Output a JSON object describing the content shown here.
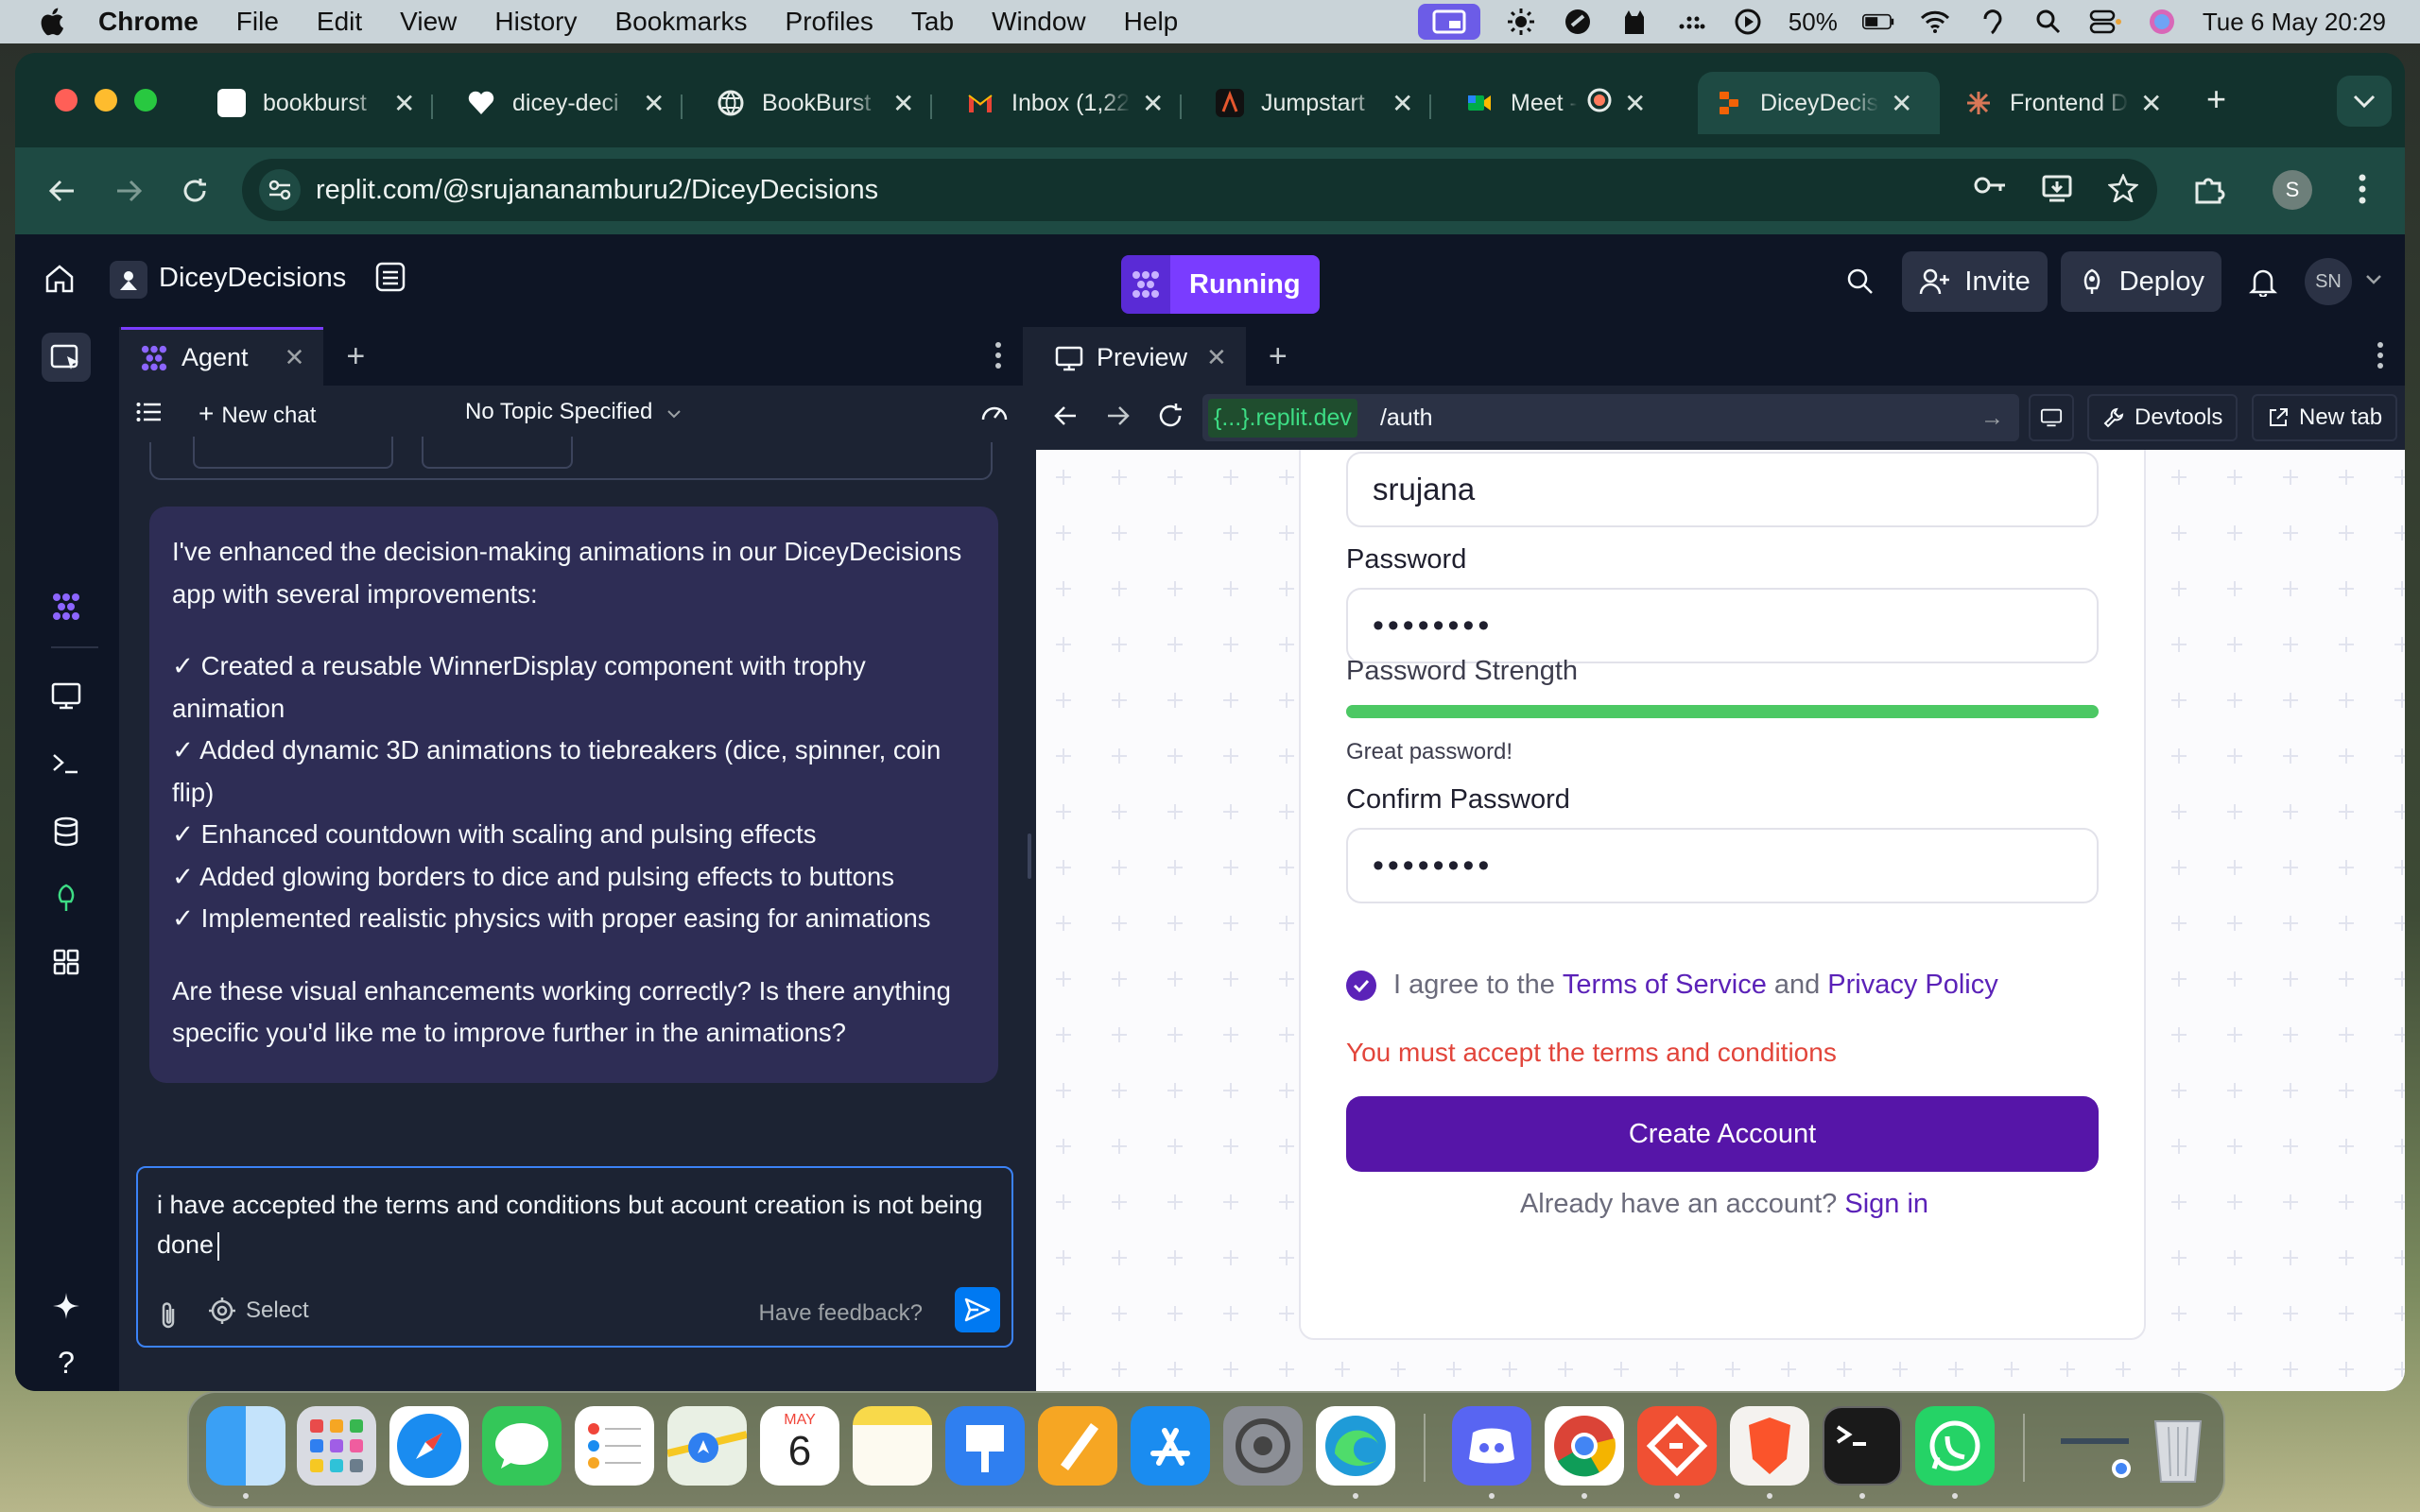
{
  "colors": {
    "replit_purple": "#7a3cff",
    "agent_bubble": "#2e2d55",
    "primary_button": "#5615a8",
    "link": "#5b22b8",
    "error": "#e2453b",
    "strength_green": "#4cc864",
    "send_blue": "#0079f2"
  },
  "menubar": {
    "app": "Chrome",
    "items": [
      "File",
      "Edit",
      "View",
      "History",
      "Bookmarks",
      "Profiles",
      "Tab",
      "Window",
      "Help"
    ],
    "battery": "50%",
    "datetime": "Tue 6 May  20:29"
  },
  "browser": {
    "tabs": [
      {
        "label": "bookburst",
        "icon": "bookburst-favicon"
      },
      {
        "label": "dicey-deci",
        "icon": "heart-favicon"
      },
      {
        "label": "BookBurst",
        "icon": "globe-favicon"
      },
      {
        "label": "Inbox (1,22",
        "icon": "gmail-favicon"
      },
      {
        "label": "Jumpstart",
        "icon": "jumpstart-favicon"
      },
      {
        "label": "Meet -",
        "icon": "meet-favicon"
      },
      {
        "label": "DiceyDecis",
        "icon": "replit-favicon"
      },
      {
        "label": "Frontend D",
        "icon": "claude-favicon"
      }
    ],
    "active_tab": 6,
    "url": "replit.com/@srujananamburu2/DiceyDecisions",
    "profile_initial": "S"
  },
  "replit": {
    "project_name": "DiceyDecisions",
    "run_label": "Running",
    "invite_label": "Invite",
    "deploy_label": "Deploy",
    "avatar_initials": "SN",
    "agent_tab": "Agent",
    "new_chat": "New chat",
    "topic": "No Topic Specified",
    "message": {
      "intro": "I've enhanced the decision-making animations in our DiceyDecisions app with several improvements:",
      "items": [
        "✓ Created a reusable WinnerDisplay component with trophy animation",
        "✓ Added dynamic 3D animations to tiebreakers (dice, spinner, coin flip)",
        "✓ Enhanced countdown with scaling and pulsing effects",
        "✓ Added glowing borders to dice and pulsing effects to buttons",
        "✓ Implemented realistic physics with proper easing for animations"
      ],
      "outro": "Are these visual enhancements working correctly? Is there anything specific you'd like me to improve further in the animations?"
    },
    "composer": {
      "text": "i have accepted the terms and conditions but acount creation is not being done",
      "select_label": "Select",
      "feedback_label": "Have feedback?"
    },
    "preview": {
      "tab_label": "Preview",
      "domain": "{...}.replit.dev",
      "path": "/auth",
      "devtools_label": "Devtools",
      "newtab_label": "New tab"
    }
  },
  "form": {
    "username_value": "srujana",
    "password_label": "Password",
    "password_value": "••••••••",
    "strength_label": "Password Strength",
    "strength_level": 1.0,
    "strength_text": "Great password!",
    "confirm_label": "Confirm Password",
    "confirm_value": "••••••••",
    "agree_prefix": "I agree to the",
    "terms_link": "Terms of Service",
    "agree_and": "and",
    "privacy_link": "Privacy Policy",
    "error_text": "You must accept the terms and conditions",
    "submit_label": "Create Account",
    "signin_prompt": "Already have an account?",
    "signin_link": "Sign in"
  },
  "dock": {
    "calendar_month": "MAY",
    "calendar_day": "6"
  }
}
